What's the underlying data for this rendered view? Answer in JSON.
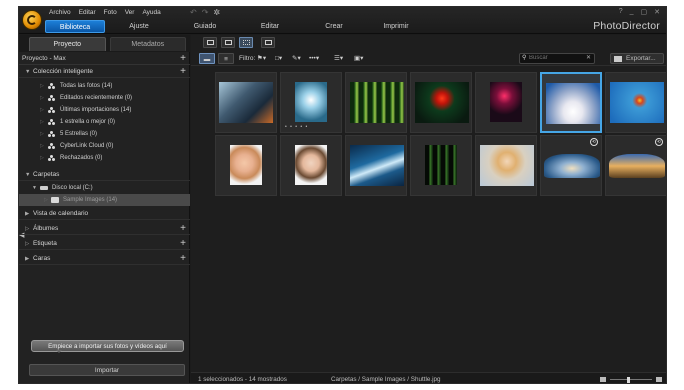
{
  "app": {
    "brand": "PhotoDirector",
    "menu": [
      "Archivo",
      "Editar",
      "Foto",
      "Ver",
      "Ayuda"
    ],
    "modes": [
      {
        "label": "Biblioteca",
        "active": true
      },
      {
        "label": "Ajuste",
        "active": false
      },
      {
        "label": "Guiado",
        "active": false
      },
      {
        "label": "Editar",
        "active": false
      },
      {
        "label": "Crear",
        "active": false
      },
      {
        "label": "Imprimir",
        "active": false
      }
    ],
    "window_controls": [
      "?",
      "_",
      "▢",
      "✕"
    ],
    "quick_icons": [
      "undo-icon",
      "redo-icon",
      "settings-icon"
    ]
  },
  "left_panel": {
    "tabs": [
      {
        "label": "Proyecto",
        "active": true
      },
      {
        "label": "Metadatos",
        "active": false
      }
    ],
    "project_name": "Proyecto - Max",
    "smart_collection": {
      "title": "Colección inteligente",
      "items": [
        "Todas las fotos (14)",
        "Editados recientemente (0)",
        "Últimas importaciones (14)",
        "1 estrella o mejor (0)",
        "5 Estrellas (0)",
        "CyberLink Cloud (0)",
        "Rechazados (0)"
      ]
    },
    "folders": {
      "title": "Carpetas",
      "disk": "Disco local (C:)",
      "folder": "Sample Images (14)"
    },
    "sections": [
      "Vista de calendario",
      "Álbumes",
      "Etiqueta",
      "Caras"
    ],
    "tooltip": "Empiece a importar sus fotos y vídeos aquí",
    "import_label": "Importar"
  },
  "toolbar": {
    "filter_label": "Filtro:",
    "search_placeholder": "Buscar",
    "export_label": "Exportar..."
  },
  "thumbnails": [
    {
      "name": "photo-concert-stage",
      "selected": false,
      "rating_dots": false,
      "badge": false
    },
    {
      "name": "photo-balloon-sky",
      "selected": false,
      "rating_dots": true,
      "badge": false
    },
    {
      "name": "photo-forest",
      "selected": false,
      "rating_dots": false,
      "badge": false
    },
    {
      "name": "photo-red-flower",
      "selected": false,
      "rating_dots": false,
      "badge": false
    },
    {
      "name": "photo-neon-portrait",
      "selected": false,
      "rating_dots": false,
      "badge": false
    },
    {
      "name": "photo-shuttle-launch",
      "selected": true,
      "rating_dots": false,
      "badge": true
    },
    {
      "name": "photo-skydiver",
      "selected": false,
      "rating_dots": false,
      "badge": false
    },
    {
      "name": "photo-woman-smile",
      "selected": false,
      "rating_dots": false,
      "badge": false
    },
    {
      "name": "photo-girl-portrait",
      "selected": false,
      "rating_dots": false,
      "badge": false
    },
    {
      "name": "photo-wave",
      "selected": false,
      "rating_dots": false,
      "badge": false
    },
    {
      "name": "photo-dark-forest",
      "selected": false,
      "rating_dots": false,
      "badge": false
    },
    {
      "name": "photo-blonde-woman",
      "selected": false,
      "rating_dots": false,
      "badge": false
    },
    {
      "name": "photo-panorama-road",
      "selected": false,
      "rating_dots": false,
      "badge": true
    },
    {
      "name": "photo-panorama-sunset",
      "selected": false,
      "rating_dots": false,
      "badge": true
    }
  ],
  "status": {
    "selection": "1 seleccionados - 14 mostrados",
    "path": "Carpetas / Sample Images / Shuttle.jpg",
    "zoom_level": 0.45
  },
  "colors": {
    "accent": "#1d7fd8",
    "selection": "#46a6e6"
  }
}
